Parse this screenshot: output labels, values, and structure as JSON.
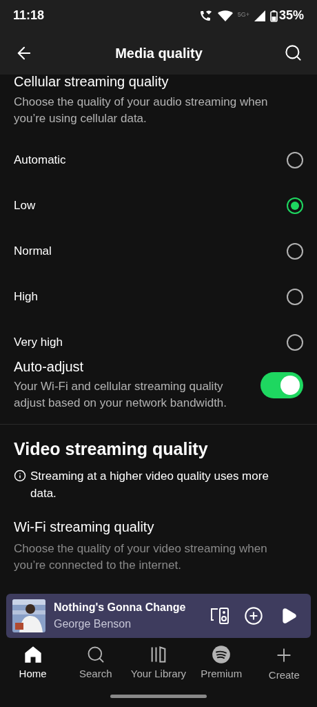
{
  "status_bar": {
    "time": "11:18",
    "network": "5G+",
    "battery": "35%"
  },
  "header": {
    "title": "Media quality"
  },
  "cellular": {
    "title": "Cellular streaming quality",
    "description": "Choose the quality of your audio streaming when you’re using cellular data.",
    "options": [
      {
        "label": "Automatic",
        "selected": false
      },
      {
        "label": "Low",
        "selected": true
      },
      {
        "label": "Normal",
        "selected": false
      },
      {
        "label": "High",
        "selected": false
      },
      {
        "label": "Very high",
        "selected": false
      }
    ]
  },
  "auto_adjust": {
    "title": "Auto-adjust",
    "description": "Your Wi-Fi and cellular streaming quality adjust based on your network bandwidth.",
    "on": true
  },
  "video": {
    "title": "Video streaming quality",
    "info": "Streaming at a higher video quality uses more data."
  },
  "wifi": {
    "title": "Wi-Fi streaming quality",
    "description": "Choose the quality of your video streaming when you’re connected to the internet."
  },
  "mini_player": {
    "track": "Nothing's Gonna Change",
    "artist": "George Benson"
  },
  "nav": [
    {
      "label": "Home",
      "selected": true,
      "kind": "home"
    },
    {
      "label": "Search",
      "selected": false,
      "kind": "search"
    },
    {
      "label": "Your Library",
      "selected": false,
      "kind": "library"
    },
    {
      "label": "Premium",
      "selected": false,
      "kind": "premium"
    },
    {
      "label": "Create",
      "selected": false,
      "kind": "create"
    }
  ]
}
